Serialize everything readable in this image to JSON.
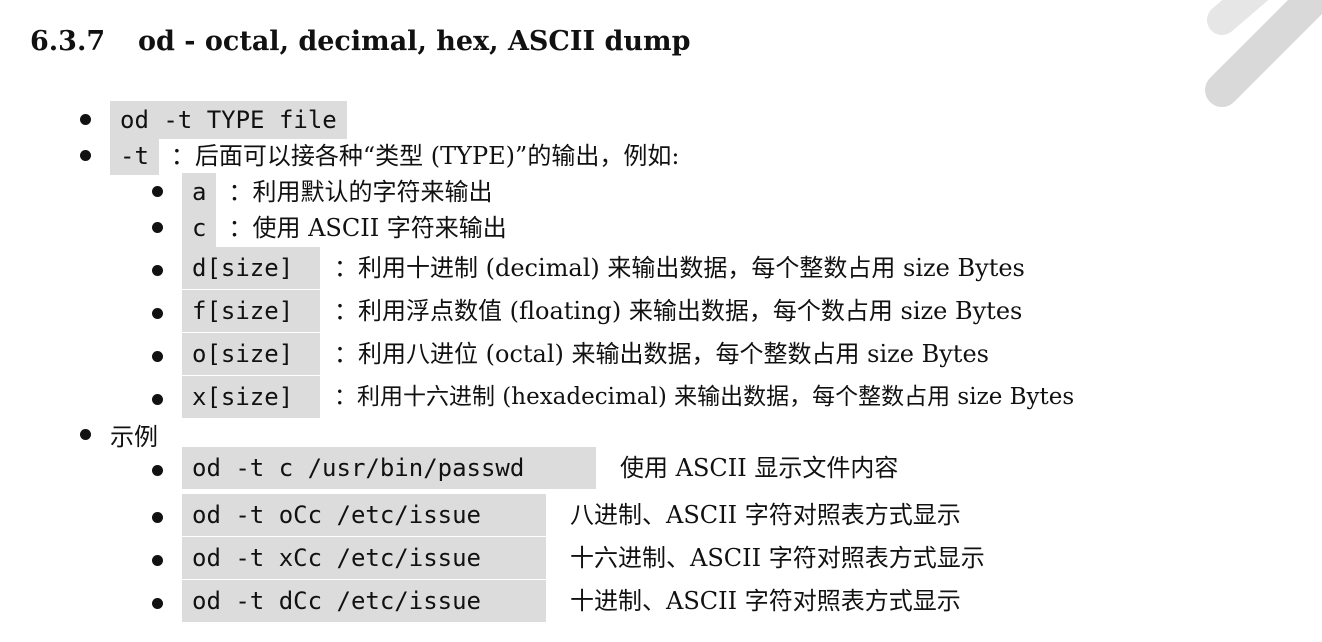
{
  "heading": {
    "number": "6.3.7",
    "title": "od - octal, decimal, hex, ASCII dump"
  },
  "items": [
    {
      "code": "od -t TYPE file",
      "desc": ""
    },
    {
      "code": "-t",
      "desc": "：后面可以接各种“类型 (TYPE)”的输出，例如:"
    }
  ],
  "types": [
    {
      "code": "a",
      "desc": "：利用默认的字符来输出"
    },
    {
      "code": "c",
      "desc": "：使用 ASCII 字符来输出"
    },
    {
      "code": "d[size]",
      "desc": "：利用十进制 (decimal) 来输出数据，每个整数占用 size Bytes"
    },
    {
      "code": "f[size]",
      "desc": "：利用浮点数值 (floating) 来输出数据，每个数占用 size Bytes"
    },
    {
      "code": "o[size]",
      "desc": "：利用八进位 (octal) 来输出数据，每个整数占用 size Bytes"
    },
    {
      "code": "x[size]",
      "desc": "：利用十六进制 (hexadecimal) 来输出数据，每个整数占用 size Bytes"
    }
  ],
  "examples_label": "示例",
  "examples": [
    {
      "code": "od -t c /usr/bin/passwd",
      "desc": "使用 ASCII 显示文件内容"
    },
    {
      "code": "od -t oCc /etc/issue",
      "desc": "八进制、ASCII 字符对照表方式显示"
    },
    {
      "code": "od -t xCc /etc/issue",
      "desc": "十六进制、ASCII 字符对照表方式显示"
    },
    {
      "code": "od -t dCc /etc/issue",
      "desc": "十进制、ASCII 字符对照表方式显示"
    }
  ],
  "colors": {
    "code_background": "#dcdcdc",
    "text": "#111111",
    "watermark": "#d9d9d9"
  }
}
